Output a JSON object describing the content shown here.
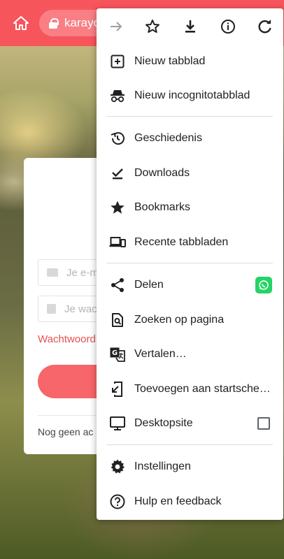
{
  "browser": {
    "url_text": "karayo",
    "toolbar_color": "#f7555c"
  },
  "page": {
    "email_placeholder": "Je e-m",
    "password_placeholder": "Je wac",
    "forgot_password": "Wachtwoord",
    "signup_prompt": "Nog geen ac"
  },
  "menu": {
    "toolbar": [
      {
        "icon": "forward-arrow-icon"
      },
      {
        "icon": "star-outline-icon"
      },
      {
        "icon": "download-icon"
      },
      {
        "icon": "info-icon"
      },
      {
        "icon": "reload-icon"
      }
    ],
    "items": [
      {
        "label": "Nieuw tabblad",
        "icon": "new-tab-icon"
      },
      {
        "label": "Nieuw incognitotabblad",
        "icon": "incognito-icon"
      },
      {
        "label": "Geschiedenis",
        "icon": "history-icon"
      },
      {
        "label": "Downloads",
        "icon": "downloads-check-icon"
      },
      {
        "label": "Bookmarks",
        "icon": "bookmark-star-icon"
      },
      {
        "label": "Recente tabbladen",
        "icon": "devices-icon"
      },
      {
        "label": "Delen",
        "icon": "share-icon"
      },
      {
        "label": "Zoeken op pagina",
        "icon": "find-in-page-icon"
      },
      {
        "label": "Vertalen…",
        "icon": "translate-icon"
      },
      {
        "label": "Toevoegen aan startsche…",
        "icon": "add-to-home-icon"
      },
      {
        "label": "Desktopsite",
        "icon": "desktop-icon"
      },
      {
        "label": "Instellingen",
        "icon": "gear-icon"
      },
      {
        "label": "Hulp en feedback",
        "icon": "help-icon"
      }
    ],
    "desktop_site_checked": false,
    "accent_whatsapp": "#25d366"
  }
}
